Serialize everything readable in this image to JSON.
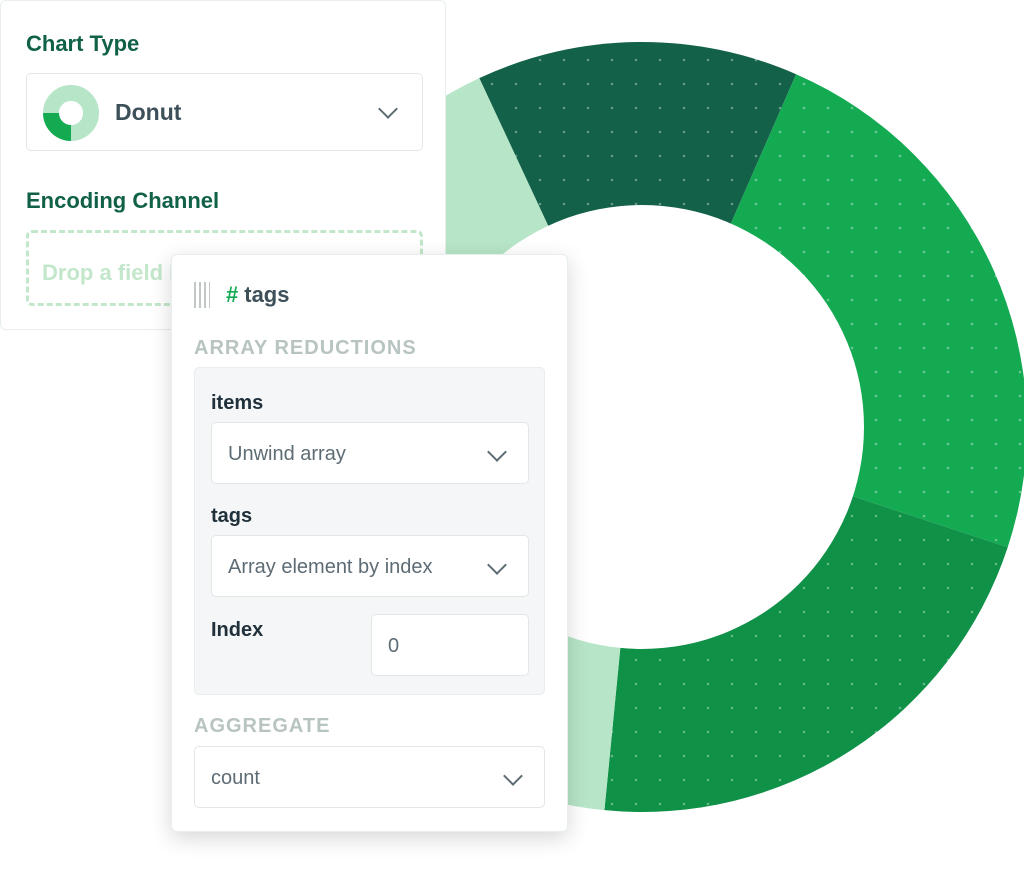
{
  "chart_data": {
    "type": "pie",
    "donut": true,
    "slices": [
      {
        "value": 0.135,
        "color": "#136149"
      },
      {
        "value": 0.235,
        "color": "#13aa52"
      },
      {
        "value": 0.215,
        "color": "#109148"
      },
      {
        "value": 0.415,
        "color": "#b7e5c7"
      }
    ]
  },
  "config": {
    "chart_type_label": "Chart Type",
    "chart_type_value": "Donut",
    "encoding_label": "Encoding Channel",
    "drop_placeholder": "Drop a field here"
  },
  "field": {
    "hash": "#",
    "name": "tags",
    "array_reductions_label": "ARRAY REDUCTIONS",
    "items_label": "items",
    "items_value": "Unwind array",
    "tags_label": "tags",
    "tags_value": "Array element by index",
    "index_label": "Index",
    "index_value": "0",
    "aggregate_label": "AGGREGATE",
    "aggregate_value": "count"
  },
  "colors": {
    "brand_green": "#13aa52",
    "dark_green": "#116149",
    "light_green": "#b7e5c7"
  }
}
